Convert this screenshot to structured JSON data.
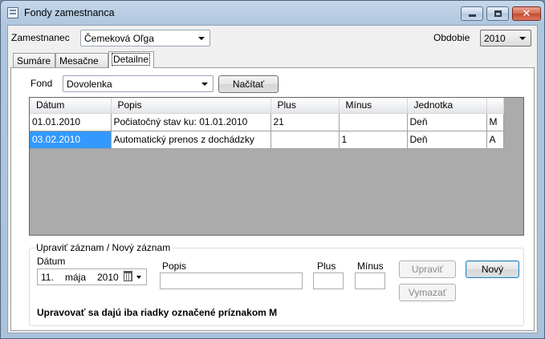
{
  "window": {
    "title": "Fondy zamestnanca"
  },
  "header": {
    "employee_label": "Zamestnanec",
    "employee_value": "Čemeková Oľga",
    "period_label": "Obdobie",
    "period_value": "2010"
  },
  "tabs": [
    {
      "label": "Sumáre",
      "active": false
    },
    {
      "label": "Mesačne",
      "active": false
    },
    {
      "label": "Detailne",
      "active": true
    }
  ],
  "detail": {
    "fund_label": "Fond",
    "fund_value": "Dovolenka",
    "load_button": "Načítať"
  },
  "grid": {
    "columns": [
      "Dátum",
      "Popis",
      "Plus",
      "Mínus",
      "Jednotka",
      ""
    ],
    "rows": [
      {
        "datum": "01.01.2010",
        "popis": "Počiatočný stav ku: 01.01.2010",
        "plus": "21",
        "minus": "",
        "jednotka": "Deň",
        "flag": "M",
        "selected": false
      },
      {
        "datum": "03.02.2010",
        "popis": "Automatický prenos z dochádzky",
        "plus": "",
        "minus": "1",
        "jednotka": "Deň",
        "flag": "A",
        "selected": true
      }
    ]
  },
  "editor": {
    "group_title": "Upraviť záznam / Nový záznam",
    "date_label": "Dátum",
    "date_day": "11.",
    "date_month": "mája",
    "date_year": "2010",
    "desc_label": "Popis",
    "desc_value": "",
    "plus_label": "Plus",
    "plus_value": "",
    "minus_label": "Mínus",
    "minus_value": "",
    "edit_button": "Upraviť",
    "delete_button": "Vymazať",
    "new_button": "Nový",
    "note": "Upravovať sa dajú iba riadky označené príznakom M"
  }
}
